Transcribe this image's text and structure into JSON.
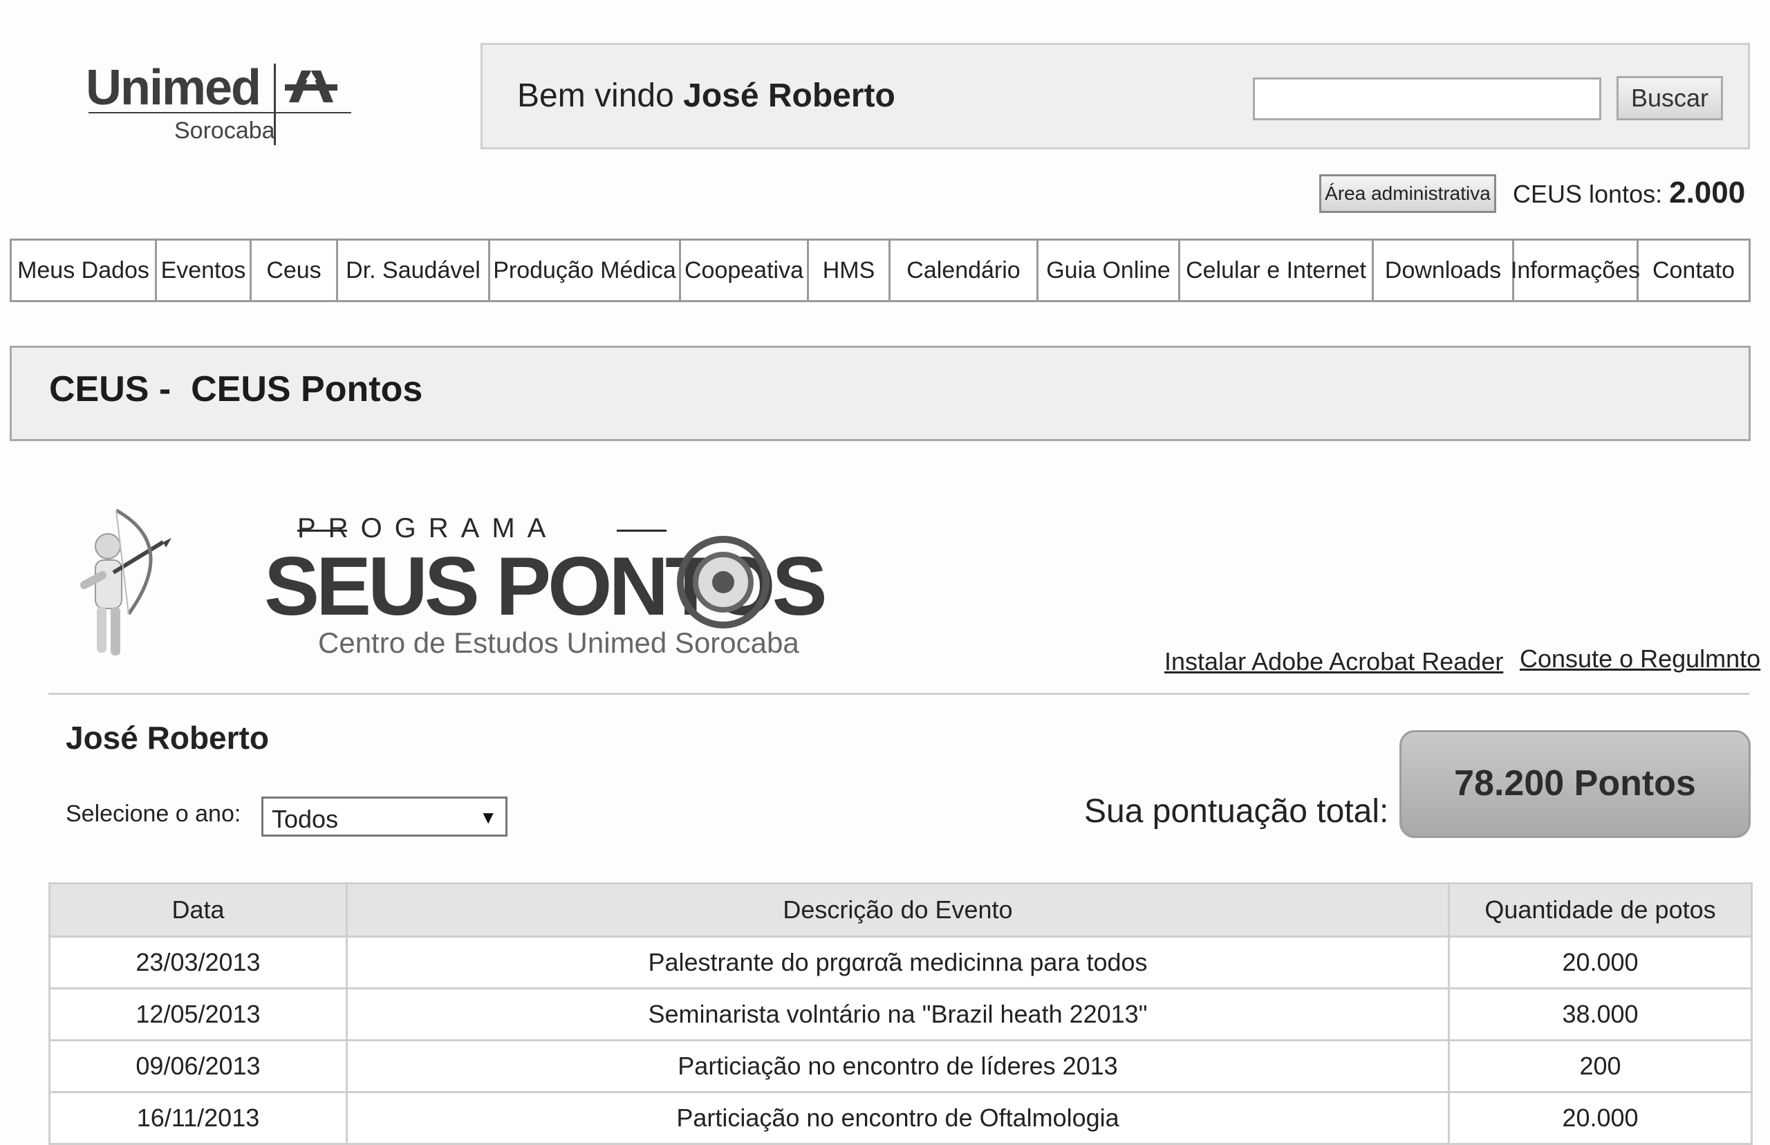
{
  "logo": {
    "brand": "Unimed",
    "city": "Sorocaba"
  },
  "header": {
    "welcome_prefix": "Bem vindo ",
    "user_name": "José Roberto",
    "search": {
      "value": "",
      "placeholder": ""
    },
    "search_button": "Buscar"
  },
  "admin": {
    "button_label": "Área administrativa",
    "points_label": "CEUS lontos:",
    "points_value": "2.000"
  },
  "nav": {
    "items": [
      {
        "label": "Meus Dados"
      },
      {
        "label": "Eventos"
      },
      {
        "label": "Ceus"
      },
      {
        "label": "Dr. Saudável"
      },
      {
        "label": "Produção Médica"
      },
      {
        "label": "Coopeativa"
      },
      {
        "label": "HMS"
      },
      {
        "label": "Calendário"
      },
      {
        "label": "Guia Online"
      },
      {
        "label": "Celular e Internet"
      },
      {
        "label": "Downloads"
      },
      {
        "label": "Informações"
      },
      {
        "label": "Contato"
      }
    ]
  },
  "section": {
    "title": "CEUS -  CEUS Pontos"
  },
  "program": {
    "kicker": "PROGRAMA",
    "title": "SEUS PONTOS",
    "subtitle": "Centro de Estudos Unimed Sorocaba"
  },
  "links": {
    "acrobat": "Instalar Adobe Acrobat Reader",
    "regulamento": "Consute o Regulmnto"
  },
  "user": {
    "name": "José Roberto"
  },
  "filter": {
    "label": "Selecione o ano:",
    "selected": "Todos"
  },
  "score": {
    "label": "Sua pontuação total:",
    "value": "78.200 Pontos"
  },
  "table": {
    "headers": [
      "Data",
      "Descrição do Evento",
      "Quantidade de potos"
    ],
    "rows": [
      [
        "23/03/2013",
        "Palestrante do prgαrα̃a medicinna para todos",
        "20.000"
      ],
      [
        "12/05/2013",
        "Seminarista volntário na \"Brazil heath 22013\"",
        "38.000"
      ],
      [
        "09/06/2013",
        "Particiação no encontro de líderes 2013",
        "200"
      ],
      [
        "16/11/2013",
        "Particiação no encontro de Oftalmologia",
        "20.000"
      ]
    ]
  },
  "colors": {
    "panel_bg": "#efefef",
    "border": "#cfcfcf",
    "score_bg": "#b8b8b8",
    "text": "#222222"
  },
  "icons": [
    "unimed-logo-icon",
    "archer-icon",
    "target-icon",
    "dropdown-arrow-icon"
  ]
}
